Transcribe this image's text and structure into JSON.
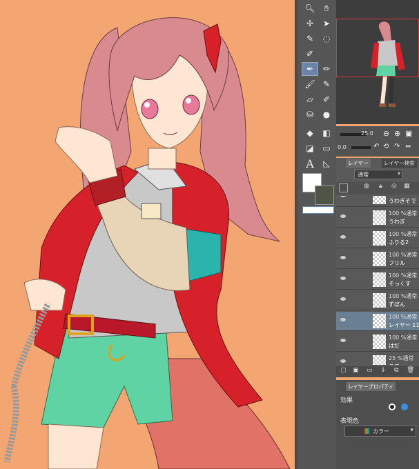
{
  "layer_panel": {
    "tab_layer": "レイヤー",
    "tab_search": "レイヤー検索",
    "blend_mode": "通常",
    "layers": [
      {
        "pct": "",
        "name": "うわぎそで"
      },
      {
        "pct": "100 %通常",
        "name": "うわぎ"
      },
      {
        "pct": "100 %通常",
        "name": "ふりる2"
      },
      {
        "pct": "100 %通常",
        "name": "フリル"
      },
      {
        "pct": "100 %通常",
        "name": "そっくす"
      },
      {
        "pct": "100 %通常",
        "name": "ずぼん"
      },
      {
        "pct": "100 %通常",
        "name": "レイヤー 11"
      },
      {
        "pct": "100 %通常",
        "name": "はだ"
      },
      {
        "pct": "25 %通常",
        "name": "ラフ"
      }
    ]
  },
  "brush": {
    "size": "25.0",
    "opacity": "0.0"
  },
  "property_panel": {
    "tab": "レイヤープロパティ",
    "effect_label": "効果",
    "color_label": "表現色",
    "color_value": "カラー"
  },
  "colors": {
    "canvas_bg": "#f3a671",
    "hair": "#d98a8f",
    "jacket": "#d6202a",
    "shirt": "#c8c8c8",
    "shorts": "#5fd3a4",
    "accent": "#2bb3ad"
  }
}
